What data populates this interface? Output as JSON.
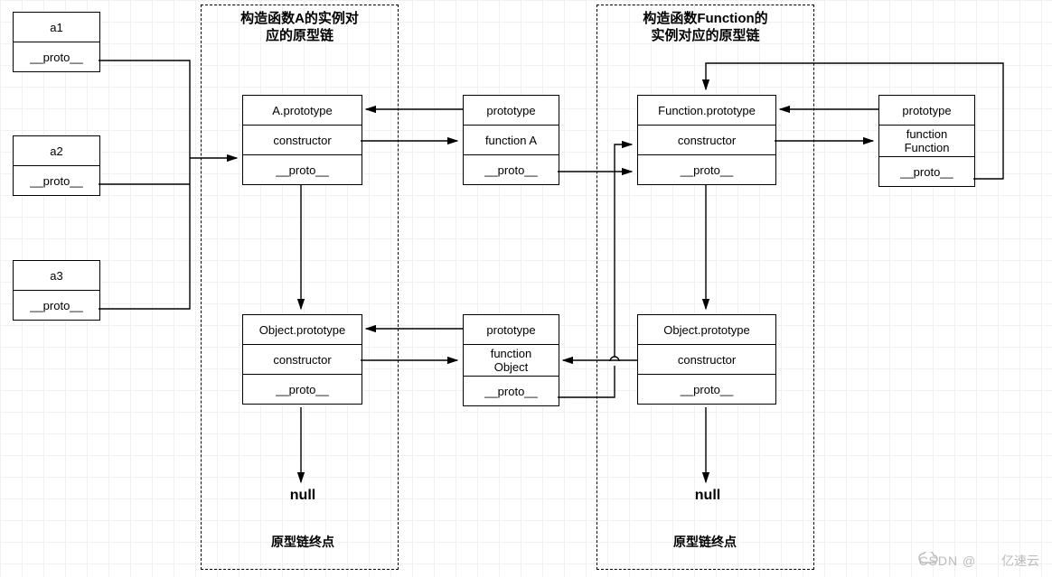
{
  "groups": {
    "A": {
      "title": "构造函数A的实例对\n应的原型链"
    },
    "F": {
      "title": "构造函数Function的\n实例对应的原型链"
    }
  },
  "instances": {
    "a1": {
      "name": "a1",
      "proto": "__proto__"
    },
    "a2": {
      "name": "a2",
      "proto": "__proto__"
    },
    "a3": {
      "name": "a3",
      "proto": "__proto__"
    }
  },
  "boxes": {
    "A_proto": {
      "r1": "A.prototype",
      "r2": "constructor",
      "r3": "__proto__"
    },
    "funcA": {
      "r1": "prototype",
      "r2": "function A",
      "r3": "__proto__"
    },
    "obj1": {
      "r1": "Object.prototype",
      "r2": "constructor",
      "r3": "__proto__"
    },
    "funcObj": {
      "r1": "prototype",
      "r2": "function\nObject",
      "r3": "__proto__"
    },
    "Fn_proto": {
      "r1": "Function.prototype",
      "r2": "constructor",
      "r3": "__proto__"
    },
    "funcFn": {
      "r1": "prototype",
      "r2": "function\nFunction",
      "r3": "__proto__"
    },
    "obj2": {
      "r1": "Object.prototype",
      "r2": "constructor",
      "r3": "__proto__"
    }
  },
  "terminal": {
    "null1": "null",
    "null2": "null",
    "end1": "原型链终点",
    "end2": "原型链终点"
  },
  "watermark": {
    "csdn": "CSDN @",
    "yun": "亿速云"
  }
}
